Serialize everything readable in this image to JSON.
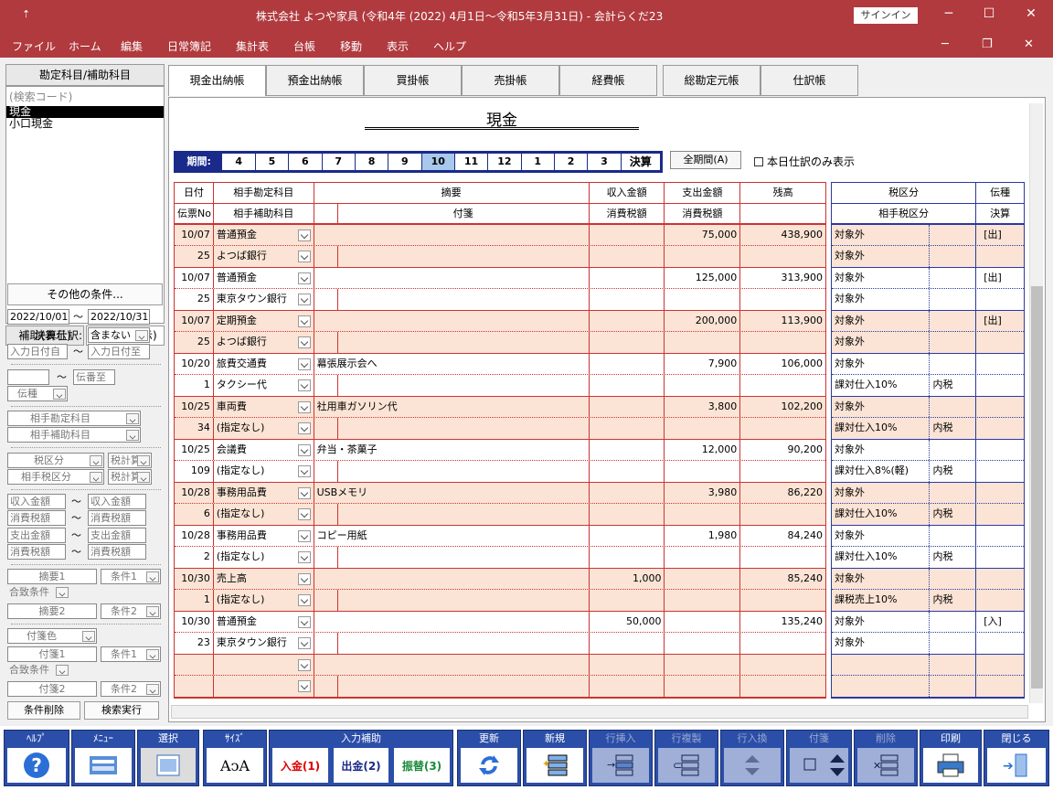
{
  "titlebar": {
    "quick": "⇡",
    "title": "株式会社 よつや家具 (令和4年 (2022) 4月1日～令和5年3月31日)  -  会計らくだ23",
    "signin": "サインイン"
  },
  "menu": [
    "ファイル",
    "ホーム",
    "編集",
    "日常簿記",
    "集計表",
    "台帳",
    "移動",
    "表示",
    "ヘルプ"
  ],
  "left": {
    "head": "勘定科目/補助科目",
    "search_placeholder": "(検索コード)",
    "items": [
      "現金",
      "小口現金"
    ],
    "sub_tabs": [
      "補助(表示)",
      "補助(非表示)"
    ],
    "other_cond": "その他の条件...",
    "date_from": "2022/10/01",
    "tilde": "～",
    "date_to": "2022/10/31",
    "kessan_label": "決算仕訳:",
    "kessan_value": "含まない",
    "input_from": "入力日付自",
    "input_to": "入力日付至",
    "den_to": "伝番至",
    "den_kind": "伝種",
    "aite_kamoku": "相手勘定科目",
    "aite_hojo": "相手補助科目",
    "tax": "税区分",
    "tax_calc": "税計算",
    "aite_tax": "相手税区分",
    "tax_calc2": "税計算",
    "in_amt": "収入金額",
    "in_amt2": "収入金額",
    "in_tax": "消費税額",
    "in_tax2": "消費税額",
    "out_amt": "支出金額",
    "out_amt2": "支出金額",
    "out_tax": "消費税額",
    "out_tax2": "消費税額",
    "desc1": "摘要1",
    "cond1": "条件1",
    "match": "合致条件",
    "desc2": "摘要2",
    "cond2": "条件2",
    "tag_color": "付箋色",
    "tag1": "付箋1",
    "tcond1": "条件1",
    "tmatch": "合致条件",
    "tag2": "付箋2",
    "tcond2": "条件2",
    "clear": "条件削除",
    "search": "検索実行"
  },
  "tabs": [
    "現金出納帳",
    "預金出納帳",
    "買掛帳",
    "売掛帳",
    "経費帳",
    "総勘定元帳",
    "仕訳帳"
  ],
  "ledger": {
    "title": "現金",
    "period_label": "期間:",
    "months": [
      "4",
      "5",
      "6",
      "7",
      "8",
      "9",
      "10",
      "11",
      "12",
      "1",
      "2",
      "3"
    ],
    "current_month": "10",
    "kessan": "決算",
    "all_period": "全期間(A)",
    "today_only": "本日仕訳のみ表示",
    "headers": {
      "date": "日付",
      "slip": "伝票No",
      "acct": "相手勘定科目",
      "sub": "相手補助科目",
      "desc": "摘要",
      "tag": "付箋",
      "in": "収入金額",
      "in_tax": "消費税額",
      "out": "支出金額",
      "out_tax": "消費税額",
      "bal": "残高",
      "taxcls": "税区分",
      "aite_taxcls": "相手税区分",
      "denshu": "伝種",
      "kessan": "決算"
    },
    "rows": [
      {
        "date": "10/07",
        "no": "25",
        "acct": "普通預金",
        "sub": "よつば銀行",
        "desc": "",
        "in": "",
        "out": "75,000",
        "bal": "438,900",
        "tax1": "対象外",
        "tax1b": "",
        "tax2": "対象外",
        "tax2b": "",
        "den": "[出]"
      },
      {
        "date": "10/07",
        "no": "25",
        "acct": "普通預金",
        "sub": "東京タウン銀行",
        "desc": "",
        "in": "",
        "out": "125,000",
        "bal": "313,900",
        "tax1": "対象外",
        "tax1b": "",
        "tax2": "対象外",
        "tax2b": "",
        "den": "[出]"
      },
      {
        "date": "10/07",
        "no": "25",
        "acct": "定期預金",
        "sub": "よつば銀行",
        "desc": "",
        "in": "",
        "out": "200,000",
        "bal": "113,900",
        "tax1": "対象外",
        "tax1b": "",
        "tax2": "対象外",
        "tax2b": "",
        "den": "[出]"
      },
      {
        "date": "10/20",
        "no": "1",
        "acct": "旅費交通費",
        "sub": "タクシー代",
        "desc": "幕張展示会へ",
        "in": "",
        "out": "7,900",
        "bal": "106,000",
        "tax1": "対象外",
        "tax1b": "",
        "tax2": "課対仕入10%",
        "tax2b": "内税",
        "den": ""
      },
      {
        "date": "10/25",
        "no": "34",
        "acct": "車両費",
        "sub": "(指定なし)",
        "desc": "社用車ガソリン代",
        "in": "",
        "out": "3,800",
        "bal": "102,200",
        "tax1": "対象外",
        "tax1b": "",
        "tax2": "課対仕入10%",
        "tax2b": "内税",
        "den": ""
      },
      {
        "date": "10/25",
        "no": "109",
        "acct": "会議費",
        "sub": "(指定なし)",
        "desc": "弁当・茶菓子",
        "in": "",
        "out": "12,000",
        "bal": "90,200",
        "tax1": "対象外",
        "tax1b": "",
        "tax2": "課対仕入8%(軽)",
        "tax2b": "内税",
        "den": ""
      },
      {
        "date": "10/28",
        "no": "6",
        "acct": "事務用品費",
        "sub": "(指定なし)",
        "desc": "USBメモリ",
        "in": "",
        "out": "3,980",
        "bal": "86,220",
        "tax1": "対象外",
        "tax1b": "",
        "tax2": "課対仕入10%",
        "tax2b": "内税",
        "den": ""
      },
      {
        "date": "10/28",
        "no": "2",
        "acct": "事務用品費",
        "sub": "(指定なし)",
        "desc": "コピー用紙",
        "in": "",
        "out": "1,980",
        "bal": "84,240",
        "tax1": "対象外",
        "tax1b": "",
        "tax2": "課対仕入10%",
        "tax2b": "内税",
        "den": ""
      },
      {
        "date": "10/30",
        "no": "1",
        "acct": "売上高",
        "sub": "(指定なし)",
        "desc": "",
        "in": "1,000",
        "out": "",
        "bal": "85,240",
        "tax1": "対象外",
        "tax1b": "",
        "tax2": "課税売上10%",
        "tax2b": "内税",
        "den": ""
      },
      {
        "date": "10/30",
        "no": "23",
        "acct": "普通預金",
        "sub": "東京タウン銀行",
        "desc": "",
        "in": "50,000",
        "out": "",
        "bal": "135,240",
        "tax1": "対象外",
        "tax1b": "",
        "tax2": "対象外",
        "tax2b": "",
        "den": "[入]"
      }
    ]
  },
  "toolbar": {
    "help": "ﾍﾙﾌﾟ",
    "menu": "ﾒﾆｭｰ",
    "select": "選択",
    "size": "ｻｲｽﾞ",
    "input_assist": "入力補助",
    "nyukin": "入金(1)",
    "shukkin": "出金(2)",
    "furikae": "振替(3)",
    "update": "更新",
    "new": "新規",
    "ins": "行挿入",
    "copy": "行複製",
    "swap": "行入換",
    "tag": "付箋",
    "del": "削除",
    "print": "印刷",
    "close": "閉じる",
    "size_glyph": "AↄA"
  }
}
